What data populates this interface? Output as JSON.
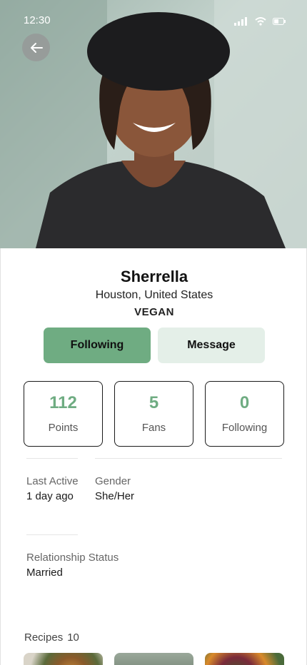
{
  "status_bar": {
    "time": "12:30"
  },
  "profile": {
    "name": "Sherrella",
    "location": "Houston, United States",
    "diet": "VEGAN"
  },
  "actions": {
    "following_label": "Following",
    "message_label": "Message"
  },
  "stats": [
    {
      "value": "112",
      "label": "Points"
    },
    {
      "value": "5",
      "label": "Fans"
    },
    {
      "value": "0",
      "label": "Following"
    }
  ],
  "details": {
    "last_active_label": "Last Active",
    "last_active_value": "1 day ago",
    "gender_label": "Gender",
    "gender_value": "She/Her",
    "relationship_label": "Relationship Status",
    "relationship_value": "Married"
  },
  "recipes": {
    "label": "Recipes",
    "count": "10"
  },
  "colors": {
    "accent": "#6fac82",
    "secondary_button": "#e4efe8"
  },
  "icons": [
    "back-arrow-icon",
    "signal-icon",
    "wifi-icon",
    "battery-icon"
  ]
}
